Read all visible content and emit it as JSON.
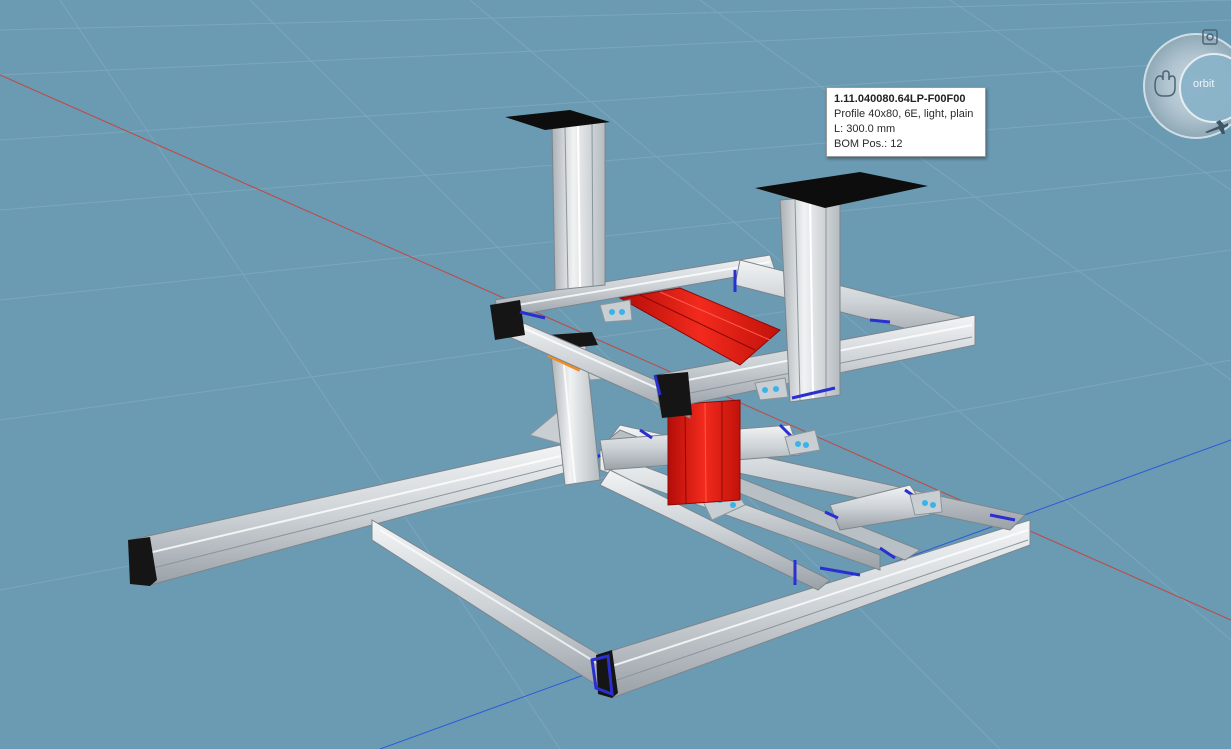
{
  "tooltip": {
    "title": "1.11.040080.64LP-F00F00",
    "description": "Profile 40x80, 6E, light, plain",
    "length": "L: 300.0 mm",
    "bom": "BOM Pos.: 12"
  },
  "navigation": {
    "wheel_label": "orbit",
    "icons": [
      "zoom-fit-icon",
      "pan-hand-icon",
      "fly-icon"
    ]
  },
  "colors": {
    "background": "#6b9ab3",
    "profile": "#cfd4d8",
    "highlight": "#e41b13",
    "connector": "#2a2fd0",
    "cap": "#111111"
  }
}
